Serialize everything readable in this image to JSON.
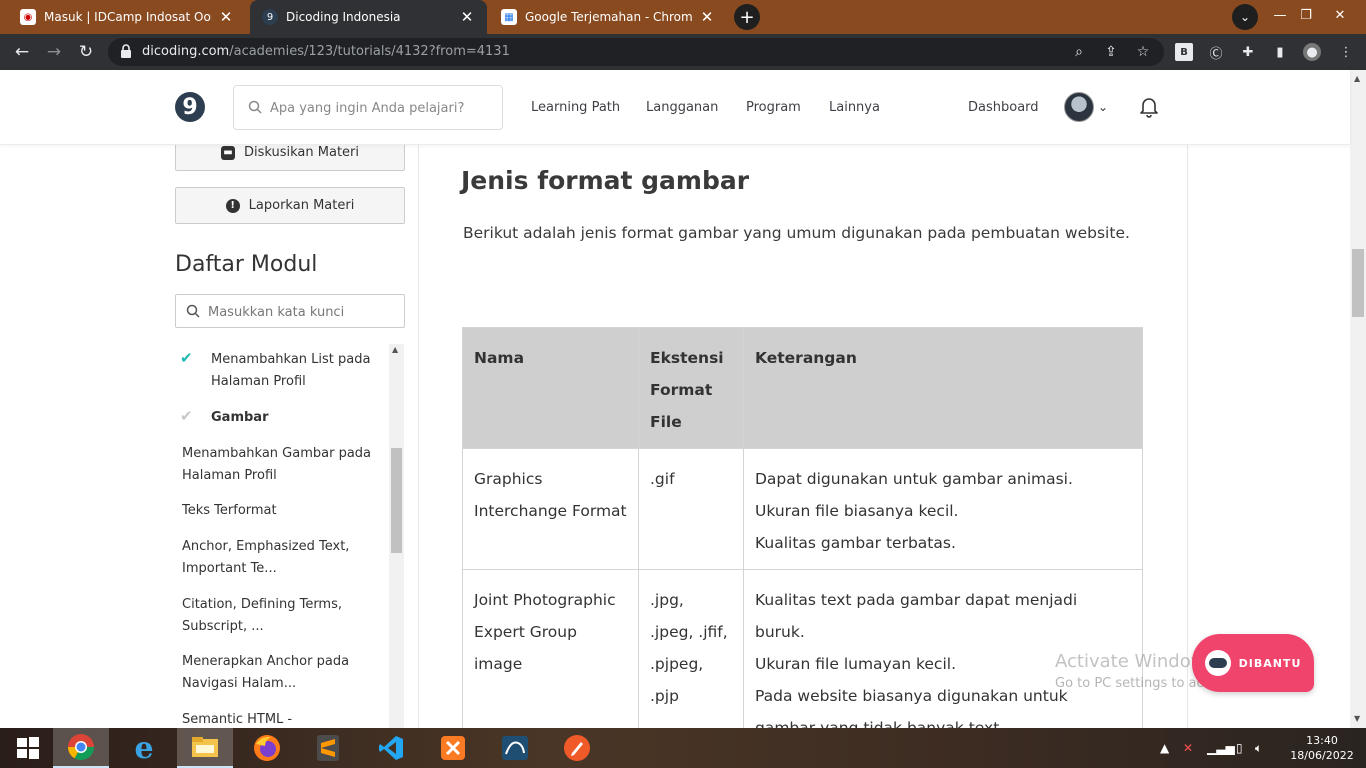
{
  "browser": {
    "tabs": [
      {
        "title": "Masuk | IDCamp Indosat Ooredo",
        "active": false
      },
      {
        "title": "Dicoding Indonesia",
        "active": true
      },
      {
        "title": "Google Terjemahan - Chrome We",
        "active": false
      }
    ],
    "url_host": "dicoding.com",
    "url_path": "/academies/123/tutorials/4132?from=4131"
  },
  "header": {
    "logo_text": "9",
    "search_placeholder": "Apa yang ingin Anda pelajari?",
    "menu": [
      "Learning Path",
      "Langganan",
      "Program",
      "Lainnya"
    ],
    "dashboard": "Dashboard"
  },
  "sidebar": {
    "discuss_label": "Diskusikan Materi",
    "report_label": "Laporkan Materi",
    "title": "Daftar Modul",
    "search_placeholder": "Masukkan kata kunci",
    "modules": [
      {
        "label": "Menambahkan List pada Halaman Profil",
        "status": "done"
      },
      {
        "label": "Gambar",
        "status": "current"
      },
      {
        "label": "Menambahkan Gambar pada Halaman Profil",
        "status": "none"
      },
      {
        "label": "Teks Terformat",
        "status": "none"
      },
      {
        "label": "Anchor, Emphasized Text, Important Te...",
        "status": "none"
      },
      {
        "label": "Citation, Defining Terms, Subscript, ...",
        "status": "none"
      },
      {
        "label": "Menerapkan Anchor pada Navigasi Halam...",
        "status": "none"
      },
      {
        "label": "Semantic HTML -",
        "status": "none"
      }
    ]
  },
  "content": {
    "title": "Jenis format gambar",
    "intro": "Berikut adalah jenis format gambar yang umum digunakan pada pembuatan website.",
    "table": {
      "headers": [
        "Nama",
        "Ekstensi Format File",
        "Keterangan"
      ],
      "rows": [
        {
          "name": "Graphics Interchange Format",
          "ext": ".gif",
          "desc": [
            "Dapat digunakan untuk gambar animasi.",
            "Ukuran file biasanya kecil.",
            "Kualitas gambar terbatas."
          ]
        },
        {
          "name": "Joint Photographic Expert Group image",
          "ext": ".jpg, .jpeg, .jfif, .pjpeg, .pjp",
          "desc": [
            "Kualitas text pada gambar dapat menjadi buruk.",
            "Ukuran file lumayan kecil.",
            "Pada website biasanya digunakan untuk gambar yang tidak banyak text."
          ]
        }
      ]
    }
  },
  "widget": {
    "dibantu_label": "DIBANTU",
    "watermark_title": "Activate Windows",
    "watermark_sub": "Go to PC settings to activate Windows."
  },
  "taskbar": {
    "time": "13:40",
    "date": "18/06/2022"
  },
  "colors": {
    "tabstrip": "#8a4a20",
    "toolbar": "#303134",
    "check_done": "#1fb7b0",
    "table_header": "#cfcfcf",
    "dibantu": "#f0446c"
  }
}
